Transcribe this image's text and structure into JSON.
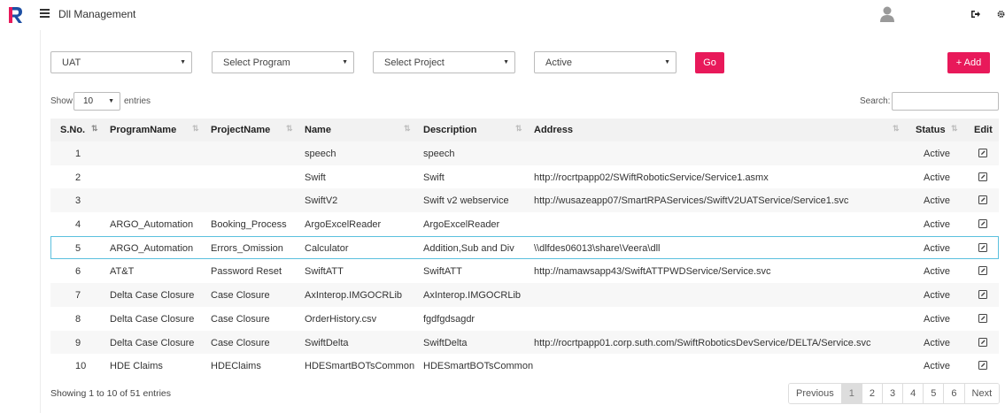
{
  "header": {
    "title": "Dll Management",
    "logo_icon": "app-logo-icon",
    "menu_icon": "hamburger-menu-icon",
    "avatar_icon": "user-avatar-icon",
    "signout_icon": "sign-out-icon",
    "settings_icon": "gear-icon"
  },
  "filters": {
    "environment": "UAT",
    "program": "Select Program",
    "project": "Select Project",
    "status": "Active",
    "go_label": "Go",
    "add_label": "+ Add"
  },
  "colors": {
    "accent": "#e8195a",
    "selected_row_border": "#5bc0de"
  },
  "table_controls": {
    "show_label": "Show",
    "entries_value": "10",
    "entries_label": "entries",
    "search_label": "Search:",
    "search_value": ""
  },
  "table": {
    "columns": [
      "S.No.",
      "ProgramName",
      "ProjectName",
      "Name",
      "Description",
      "Address",
      "Status",
      "Edit"
    ],
    "rows": [
      {
        "sno": "1",
        "program": "",
        "project": "",
        "name": "speech",
        "description": "speech",
        "address": "",
        "status": "Active"
      },
      {
        "sno": "2",
        "program": "",
        "project": "",
        "name": "Swift",
        "description": "Swift",
        "address": "http://rocrtpapp02/SWiftRoboticService/Service1.asmx",
        "status": "Active"
      },
      {
        "sno": "3",
        "program": "",
        "project": "",
        "name": "SwiftV2",
        "description": "Swift v2 webservice",
        "address": "http://wusazeapp07/SmartRPAServices/SwiftV2UATService/Service1.svc",
        "status": "Active"
      },
      {
        "sno": "4",
        "program": "ARGO_Automation",
        "project": "Booking_Process",
        "name": "ArgoExcelReader",
        "description": "ArgoExcelReader",
        "address": "",
        "status": "Active"
      },
      {
        "sno": "5",
        "program": "ARGO_Automation",
        "project": "Errors_Omission",
        "name": "Calculator",
        "description": "Addition,Sub and Div",
        "address": "\\\\dlfdes06013\\share\\Veera\\dll",
        "status": "Active"
      },
      {
        "sno": "6",
        "program": "AT&T",
        "project": "Password Reset",
        "name": "SwiftATT",
        "description": "SwiftATT",
        "address": "http://namawsapp43/SwiftATTPWDService/Service.svc",
        "status": "Active"
      },
      {
        "sno": "7",
        "program": "Delta Case Closure",
        "project": "Case Closure",
        "name": "AxInterop.IMGOCRLib",
        "description": "AxInterop.IMGOCRLib",
        "address": "",
        "status": "Active"
      },
      {
        "sno": "8",
        "program": "Delta Case Closure",
        "project": "Case Closure",
        "name": "OrderHistory.csv",
        "description": "fgdfgdsagdr",
        "address": "",
        "status": "Active"
      },
      {
        "sno": "9",
        "program": "Delta Case Closure",
        "project": "Case Closure",
        "name": "SwiftDelta",
        "description": "SwiftDelta",
        "address": "http://rocrtpapp01.corp.suth.com/SwiftRoboticsDevService/DELTA/Service.svc",
        "status": "Active"
      },
      {
        "sno": "10",
        "program": "HDE Claims",
        "project": "HDEClaims",
        "name": "HDESmartBOTsCommon",
        "description": "HDESmartBOTsCommon",
        "address": "",
        "status": "Active"
      }
    ],
    "selected_row": 5
  },
  "footer": {
    "info": "Showing 1 to 10 of 51 entries",
    "pager": [
      "Previous",
      "1",
      "2",
      "3",
      "4",
      "5",
      "6",
      "Next"
    ],
    "active_page": "1"
  }
}
